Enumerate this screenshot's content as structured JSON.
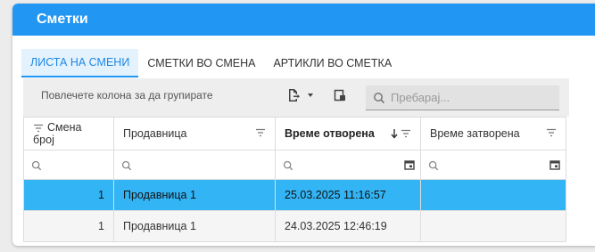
{
  "header": {
    "title": "Сметки"
  },
  "tabs": [
    {
      "label": "ЛИСТА НА СМЕНИ",
      "active": true
    },
    {
      "label": "СМЕТКИ ВО СМЕНА",
      "active": false
    },
    {
      "label": "АРТИКЛИ ВО СМЕТКА",
      "active": false
    }
  ],
  "toolbar": {
    "group_hint": "Повлечете колона за да групирате",
    "export_icon": "export-icon",
    "search_placeholder": "Пребарај..."
  },
  "grid": {
    "columns": [
      {
        "label": "Смена број"
      },
      {
        "label": "Продавница"
      },
      {
        "label": "Време отворена",
        "sort": "descending"
      },
      {
        "label": "Време затворена"
      }
    ],
    "rows": [
      {
        "shift": "1",
        "store": "Продавница 1",
        "opened": "25.03.2025 11:16:57",
        "closed": "",
        "selected": true
      },
      {
        "shift": "1",
        "store": "Продавница 1",
        "opened": "24.03.2025 12:46:19",
        "closed": "",
        "selected": false
      }
    ]
  },
  "colors": {
    "accent": "#2196f3",
    "selected_row": "#33b5f5"
  }
}
